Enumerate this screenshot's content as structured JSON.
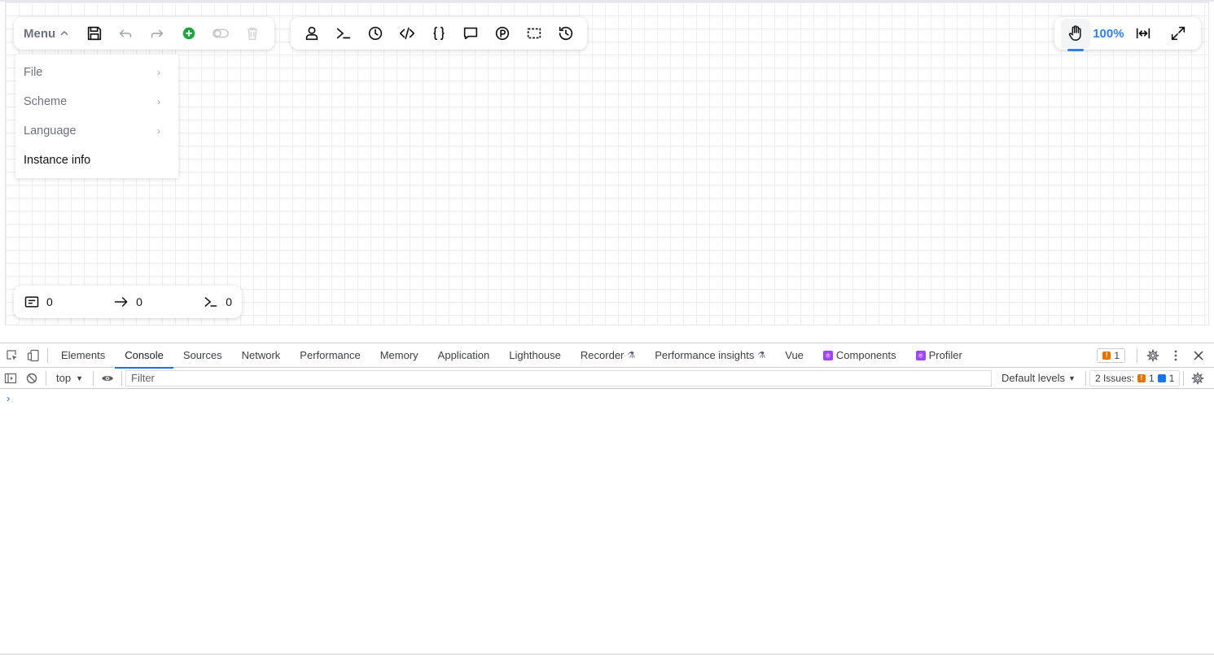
{
  "toolbar": {
    "menu_label": "Menu",
    "zoom_level": "100%"
  },
  "menu": {
    "items": [
      {
        "label": "File",
        "has_submenu": true
      },
      {
        "label": "Scheme",
        "has_submenu": true
      },
      {
        "label": "Language",
        "has_submenu": true
      },
      {
        "label": "Instance info",
        "has_submenu": false
      }
    ]
  },
  "stats": {
    "nodes": "0",
    "links": "0",
    "scripts": "0"
  },
  "devtools": {
    "tabs": [
      "Elements",
      "Console",
      "Sources",
      "Network",
      "Performance",
      "Memory",
      "Application",
      "Lighthouse",
      "Recorder",
      "Performance insights",
      "Vue",
      "Components",
      "Profiler"
    ],
    "active_tab": "Console",
    "warning_count": "1",
    "context": "top",
    "filter_placeholder": "Filter",
    "levels": "Default levels",
    "issues_label": "2 Issues:",
    "issues_warn": "1",
    "issues_info": "1",
    "prompt": "›"
  },
  "colors": {
    "accent": "#2f80ed",
    "add_green": "#22a447",
    "devtools_blue": "#1a73e8",
    "warning": "#e37400"
  }
}
